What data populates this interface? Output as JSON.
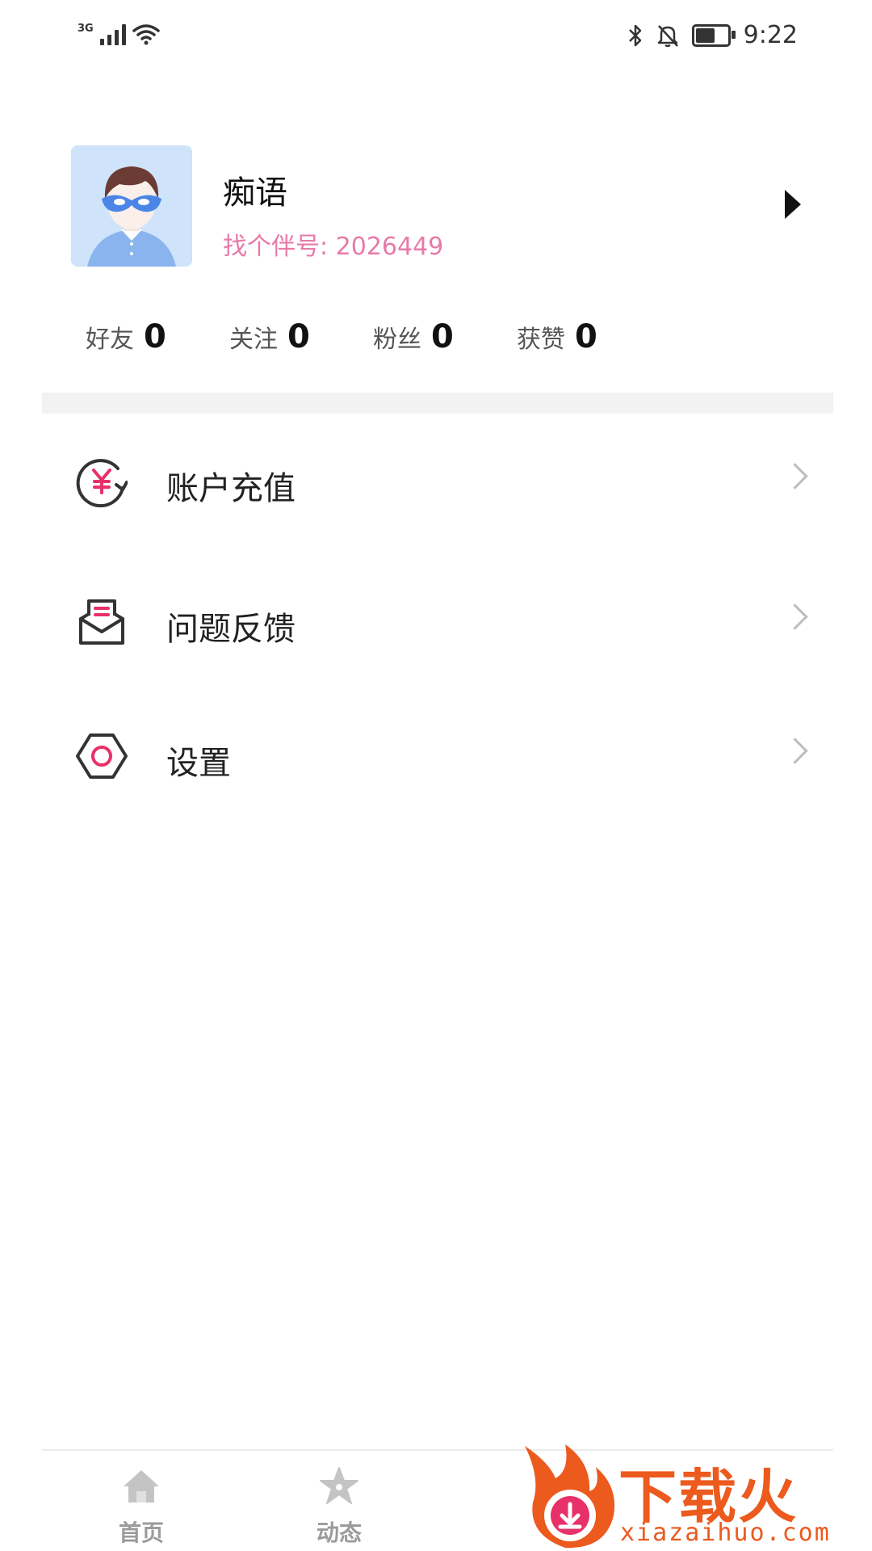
{
  "status_bar": {
    "network": "3G",
    "time": "9:22",
    "battery_level": 0.55,
    "icons": [
      "signal-icon",
      "wifi-icon",
      "bluetooth-icon",
      "mute-bell-icon",
      "battery-icon"
    ]
  },
  "profile": {
    "name": "痴语",
    "id_label": "找个伴号:",
    "id_value": "2026449"
  },
  "stats": [
    {
      "label": "好友",
      "value": "0"
    },
    {
      "label": "关注",
      "value": "0"
    },
    {
      "label": "粉丝",
      "value": "0"
    },
    {
      "label": "获赞",
      "value": "0"
    }
  ],
  "menu": [
    {
      "label": "账户充值",
      "icon": "recharge-yen-icon"
    },
    {
      "label": "问题反馈",
      "icon": "feedback-envelope-icon"
    },
    {
      "label": "设置",
      "icon": "settings-hexagon-icon"
    }
  ],
  "tabs": [
    {
      "label": "首页",
      "icon": "home-icon"
    },
    {
      "label": "动态",
      "icon": "star-icon"
    }
  ],
  "watermark": {
    "title": "下载火",
    "site": "xiazaihuo.com"
  },
  "colors": {
    "accent_pink": "#e87aa8",
    "icon_pink": "#e8306a",
    "watermark_orange": "#ec5a1e"
  }
}
